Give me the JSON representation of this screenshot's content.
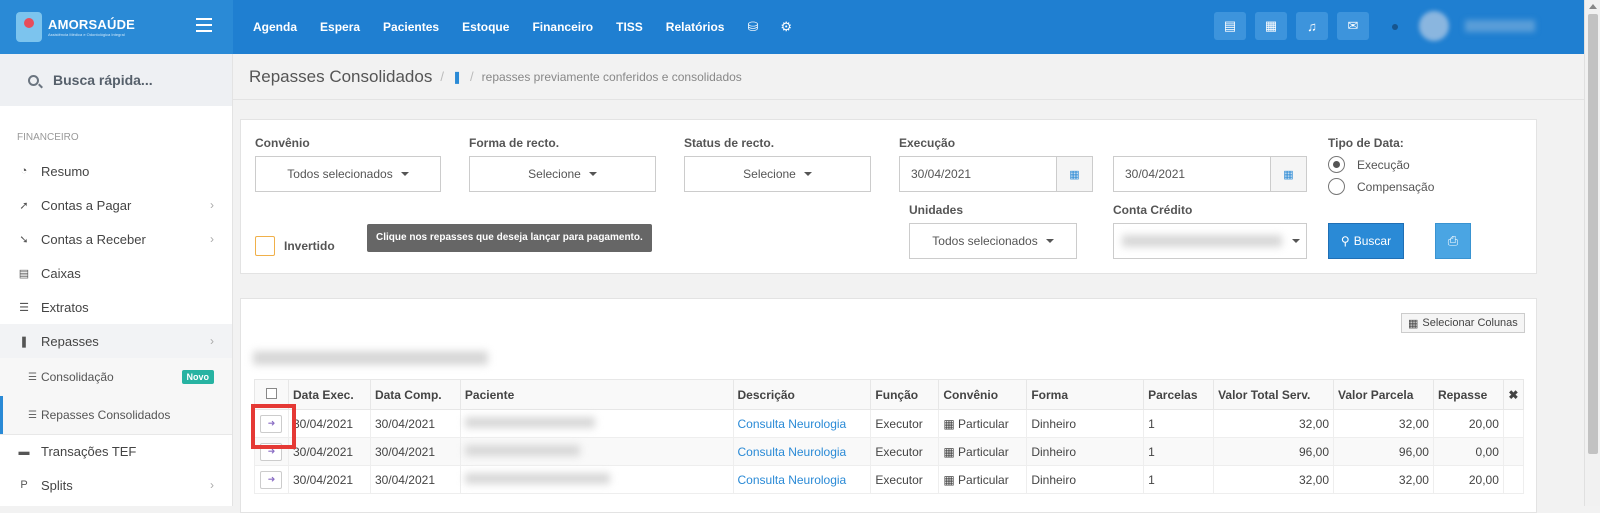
{
  "topbar": {
    "brand": "AMORSAÚDE",
    "brand_sub": "Assistência Médica e Odontológica Integral",
    "menu": [
      "Agenda",
      "Espera",
      "Pacientes",
      "Estoque",
      "Financeiro",
      "TISS",
      "Relatórios"
    ]
  },
  "sidebar": {
    "search_placeholder": "Busca rápida...",
    "section": "FINANCEIRO",
    "items": {
      "resumo": "Resumo",
      "contas_pagar": "Contas a Pagar",
      "contas_receber": "Contas a Receber",
      "caixas": "Caixas",
      "extratos": "Extratos",
      "repasses": "Repasses",
      "consolidacao": "Consolidação",
      "consolidacao_badge": "Novo",
      "repasses_consolidados": "Repasses Consolidados",
      "transacoes_tef": "Transações TEF",
      "splits": "Splits"
    }
  },
  "breadcrumb": {
    "title": "Repasses Consolidados",
    "sub": "repasses previamente conferidos e consolidados"
  },
  "filters": {
    "convenio_label": "Convênio",
    "convenio_value": "Todos selecionados",
    "forma_label": "Forma de recto.",
    "forma_value": "Selecione",
    "status_label": "Status de recto.",
    "status_value": "Selecione",
    "execucao_label": "Execução",
    "date_from": "30/04/2021",
    "date_to": "30/04/2021",
    "tipo_label": "Tipo de Data:",
    "radio_execucao": "Execução",
    "radio_compensacao": "Compensação",
    "unidades_label": "Unidades",
    "unidades_value": "Todos selecionados",
    "conta_label": "Conta Crédito",
    "invertido_label": "Invertido",
    "tooltip": "Clique nos repasses que deseja lançar para pagamento.",
    "buscar": "Buscar"
  },
  "results": {
    "select_columns": "Selecionar Colunas",
    "headers": [
      "Data Exec.",
      "Data Comp.",
      "Paciente",
      "Descrição",
      "Função",
      "Convênio",
      "Forma",
      "Parcelas",
      "Valor Total Serv.",
      "Valor Parcela",
      "Repasse"
    ],
    "rows": [
      {
        "data_exec": "30/04/2021",
        "data_comp": "30/04/2021",
        "descricao": "Consulta Neurologia",
        "funcao": "Executor",
        "convenio": "Particular",
        "forma": "Dinheiro",
        "parcelas": "1",
        "valor_total": "32,00",
        "valor_parcela": "32,00",
        "repasse": "20,00"
      },
      {
        "data_exec": "30/04/2021",
        "data_comp": "30/04/2021",
        "descricao": "Consulta Neurologia",
        "funcao": "Executor",
        "convenio": "Particular",
        "forma": "Dinheiro",
        "parcelas": "1",
        "valor_total": "96,00",
        "valor_parcela": "96,00",
        "repasse": "0,00"
      },
      {
        "data_exec": "30/04/2021",
        "data_comp": "30/04/2021",
        "descricao": "Consulta Neurologia",
        "funcao": "Executor",
        "convenio": "Particular",
        "forma": "Dinheiro",
        "parcelas": "1",
        "valor_total": "32,00",
        "valor_parcela": "32,00",
        "repasse": "20,00"
      }
    ]
  }
}
